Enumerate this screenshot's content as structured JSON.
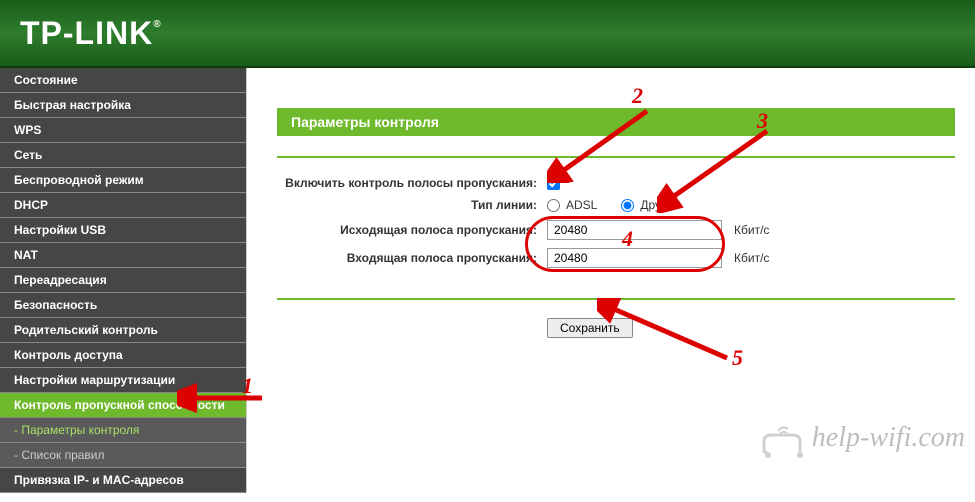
{
  "brand": "TP-LINK",
  "sidebar": {
    "items": [
      {
        "label": "Состояние"
      },
      {
        "label": "Быстрая настройка"
      },
      {
        "label": "WPS"
      },
      {
        "label": "Сеть"
      },
      {
        "label": "Беспроводной режим"
      },
      {
        "label": "DHCP"
      },
      {
        "label": "Настройки USB"
      },
      {
        "label": "NAT"
      },
      {
        "label": "Переадресация"
      },
      {
        "label": "Безопасность"
      },
      {
        "label": "Родительский контроль"
      },
      {
        "label": "Контроль доступа"
      },
      {
        "label": "Настройки маршрутизации"
      },
      {
        "label": "Контроль пропускной способности",
        "active": true
      },
      {
        "label": "Привязка IP- и MAC-адресов"
      }
    ],
    "subitems": [
      {
        "label": "- Параметры контроля",
        "active": true
      },
      {
        "label": "- Список правил"
      }
    ]
  },
  "panel": {
    "title": "Параметры контроля",
    "fields": {
      "enable_label": "Включить контроль полосы пропускания:",
      "enable_checked": true,
      "line_type_label": "Тип линии:",
      "line_adsl": "ADSL",
      "line_other": "Другая",
      "line_selected": "other",
      "egress_label": "Исходящая полоса пропускания:",
      "egress_value": "20480",
      "ingress_label": "Входящая полоса пропускания:",
      "ingress_value": "20480",
      "unit": "Кбит/с"
    },
    "save_label": "Сохранить"
  },
  "annotations": {
    "n1": "1",
    "n2": "2",
    "n3": "3",
    "n4": "4",
    "n5": "5"
  },
  "watermark": "help-wifi.com"
}
